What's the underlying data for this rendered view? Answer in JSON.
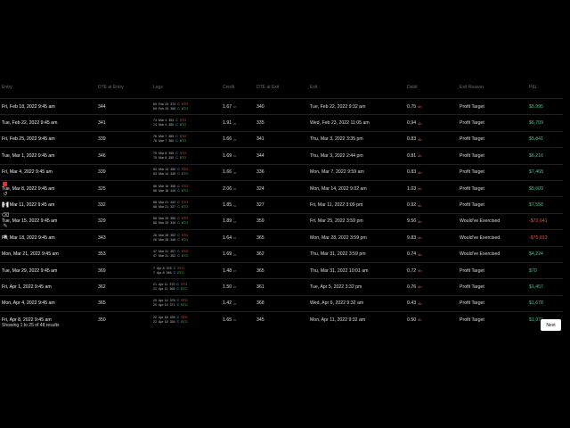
{
  "header": {
    "entry": "Entry",
    "dte": "DTE at Entry",
    "legs": "Legs",
    "credit": "Credit",
    "dte_exit": "DTE at Exit",
    "exit": "Exit",
    "debit": "Debit",
    "reason": "Exit Reason",
    "pnl": "P&L"
  },
  "rows": [
    {
      "entry": "Fri, Feb 18, 2022 9:45 am",
      "dte": "344",
      "legs": [
        [
          "69",
          "Feb 25",
          "373",
          "C",
          "STO"
        ],
        [
          "69",
          "Feb 25",
          "369",
          "C",
          "BTO"
        ]
      ],
      "credit": "1.67",
      "dte_exit": "340",
      "exit": "Tue, Feb 22, 2022 9:32 am",
      "debit": "0.75",
      "reason": "Profit Target",
      "pnl": "$5,995",
      "pnl_sign": "pos"
    },
    {
      "entry": "Tue, Feb 22, 2022 9:45 am",
      "dte": "341",
      "legs": [
        [
          "74",
          "Mar 4",
          "353",
          "C",
          "STO"
        ],
        [
          "74",
          "Mar 4",
          "350",
          "C",
          "BTO"
        ]
      ],
      "credit": "1.91",
      "dte_exit": "335",
      "exit": "Wed, Feb 23, 2022 11:05 am",
      "debit": "0.94",
      "reason": "Profit Target",
      "pnl": "$6,709",
      "pnl_sign": "pos"
    },
    {
      "entry": "Fri, Feb 25, 2022 9:45 am",
      "dte": "339",
      "legs": [
        [
          "76",
          "Mar 7",
          "365",
          "C",
          "STO"
        ],
        [
          "76",
          "Mar 7",
          "360",
          "C",
          "BTO"
        ]
      ],
      "credit": "1.66",
      "dte_exit": "341",
      "exit": "Thu, Mar 3, 2022 3:35 pm",
      "debit": "0.83",
      "reason": "Profit Target",
      "pnl": "$5,841",
      "pnl_sign": "pos"
    },
    {
      "entry": "Tue, Mar 1, 2022 9:45 am",
      "dte": "346",
      "legs": [
        [
          "75",
          "Mar 8",
          "355",
          "C",
          "STO"
        ],
        [
          "75",
          "Mar 8",
          "350",
          "C",
          "BTO"
        ]
      ],
      "credit": "1.69",
      "dte_exit": "344",
      "exit": "Thu, Mar 3, 2022 2:44 pm",
      "debit": "0.81",
      "reason": "Profit Target",
      "pnl": "$6,216",
      "pnl_sign": "pos"
    },
    {
      "entry": "Fri, Mar 4, 2022 9:45 am",
      "dte": "339",
      "legs": [
        [
          "83",
          "Mar 14",
          "350",
          "C",
          "STO"
        ],
        [
          "83",
          "Mar 14",
          "345",
          "C",
          "BTO"
        ]
      ],
      "credit": "1.66",
      "dte_exit": "336",
      "exit": "Mon, Mar 7, 2022 9:59 am",
      "debit": "0.83",
      "reason": "Profit Target",
      "pnl": "$7,468",
      "pnl_sign": "pos"
    },
    {
      "entry": "Tue, Mar 8, 2022 9:45 am",
      "dte": "325",
      "legs": [
        [
          "86",
          "Mar 18",
          "355",
          "C",
          "STO"
        ],
        [
          "86",
          "Mar 18",
          "349",
          "C",
          "BTO"
        ]
      ],
      "credit": "2.06",
      "dte_exit": "324",
      "exit": "Mon, Mar 14, 2022 9:32 am",
      "debit": "1.03",
      "reason": "Profit Target",
      "pnl": "$9,609",
      "pnl_sign": "pos"
    },
    {
      "entry": "Fri, Mar 11, 2022 9:45 am",
      "dte": "332",
      "legs": [
        [
          "88",
          "Mar 21",
          "342",
          "C",
          "STO"
        ],
        [
          "88",
          "Mar 21",
          "337",
          "C",
          "BTO"
        ]
      ],
      "credit": "1.85",
      "dte_exit": "327",
      "exit": "Fri, Mar 11, 2022 3:09 pm",
      "debit": "0.92",
      "reason": "Profit Target",
      "pnl": "$7,558",
      "pnl_sign": "pos"
    },
    {
      "entry": "Tue, Mar 15, 2022 9:45 am",
      "dte": "329",
      "legs": [
        [
          "85",
          "Mar 25",
          "355",
          "C",
          "STO"
        ],
        [
          "85",
          "Mar 25",
          "349",
          "C",
          "BTO"
        ]
      ],
      "credit": "1.89",
      "dte_exit": "359",
      "exit": "Fri, Mar 25, 2022 3:59 pm",
      "debit": "9.56",
      "reason": "Would've Exercised",
      "pnl": "-$72,641",
      "pnl_sign": "neg"
    },
    {
      "entry": "Fri, Mar 18, 2022 9:45 am",
      "dte": "343",
      "legs": [
        [
          "26",
          "Mar 28",
          "352",
          "C",
          "STO"
        ],
        [
          "26",
          "Mar 28",
          "348",
          "C",
          "BTO"
        ]
      ],
      "credit": "1.64",
      "dte_exit": "365",
      "exit": "Mon, Mar 28, 2022 3:59 pm",
      "debit": "9.83",
      "reason": "Would've Exercised",
      "pnl": "-$75,013",
      "pnl_sign": "neg"
    },
    {
      "entry": "Mon, Mar 21, 2022 9:45 am",
      "dte": "353",
      "legs": [
        [
          "47",
          "Mar 31",
          "357",
          "C",
          "STO"
        ],
        [
          "47",
          "Mar 31",
          "352",
          "C",
          "BTO"
        ]
      ],
      "credit": "1.69",
      "dte_exit": "362",
      "exit": "Thu, Mar 31, 2022 3:59 pm",
      "debit": "0.74",
      "reason": "Would've Exercised",
      "pnl": "$4,224",
      "pnl_sign": "pos"
    },
    {
      "entry": "Tue, Mar 29, 2022 9:45 am",
      "dte": "369",
      "legs": [
        [
          "7",
          "Apr 8",
          "376",
          "C",
          "STO"
        ],
        [
          "7",
          "Apr 8",
          "366",
          "C",
          "BTO"
        ]
      ],
      "credit": "1.48",
      "dte_exit": "365",
      "exit": "Thu, Mar 31, 2022 10:01 am",
      "debit": "0.72",
      "reason": "Profit Target",
      "pnl": "$70",
      "pnl_sign": "pos"
    },
    {
      "entry": "Fri, Apr 1, 2022 9:45 am",
      "dte": "362",
      "legs": [
        [
          "21",
          "Apr 11",
          "370",
          "C",
          "STO"
        ],
        [
          "21",
          "Apr 11",
          "365",
          "C",
          "BTO"
        ]
      ],
      "credit": "1.50",
      "dte_exit": "361",
      "exit": "Tue, Apr 5, 2022 3:32 pm",
      "debit": "0.76",
      "reason": "Profit Target",
      "pnl": "$1,457",
      "pnl_sign": "pos"
    },
    {
      "entry": "Mon, Apr 4, 2022 9:45 am",
      "dte": "365",
      "legs": [
        [
          "20",
          "Apr 14",
          "376",
          "C",
          "STO"
        ],
        [
          "20",
          "Apr 14",
          "371",
          "C",
          "BTO"
        ]
      ],
      "credit": "1.42",
      "dte_exit": "368",
      "exit": "Wed, Apr 6, 2022 9:32 am",
      "debit": "0.43",
      "reason": "Profit Target",
      "pnl": "$1,678",
      "pnl_sign": "pos"
    },
    {
      "entry": "Fri, Apr 8, 2022 9:45 am",
      "dte": "350",
      "legs": [
        [
          "22",
          "Apr 18",
          "359",
          "C",
          "STO"
        ],
        [
          "22",
          "Apr 18",
          "354",
          "C",
          "BTO"
        ]
      ],
      "credit": "1.65",
      "dte_exit": "345",
      "exit": "Mon, Apr 11, 2022 9:32 am",
      "debit": "0.50",
      "reason": "Profit Target",
      "pnl": "$1,977",
      "pnl_sign": "pos"
    }
  ],
  "units": {
    "credit": "cr",
    "debit": "db"
  },
  "footer": {
    "showing": "Showing 1 to 25 of 48 results",
    "next": "Next"
  },
  "colors": {
    "positive": "#46c08a",
    "negative": "#e0553c",
    "call": "#4fb3ff"
  }
}
